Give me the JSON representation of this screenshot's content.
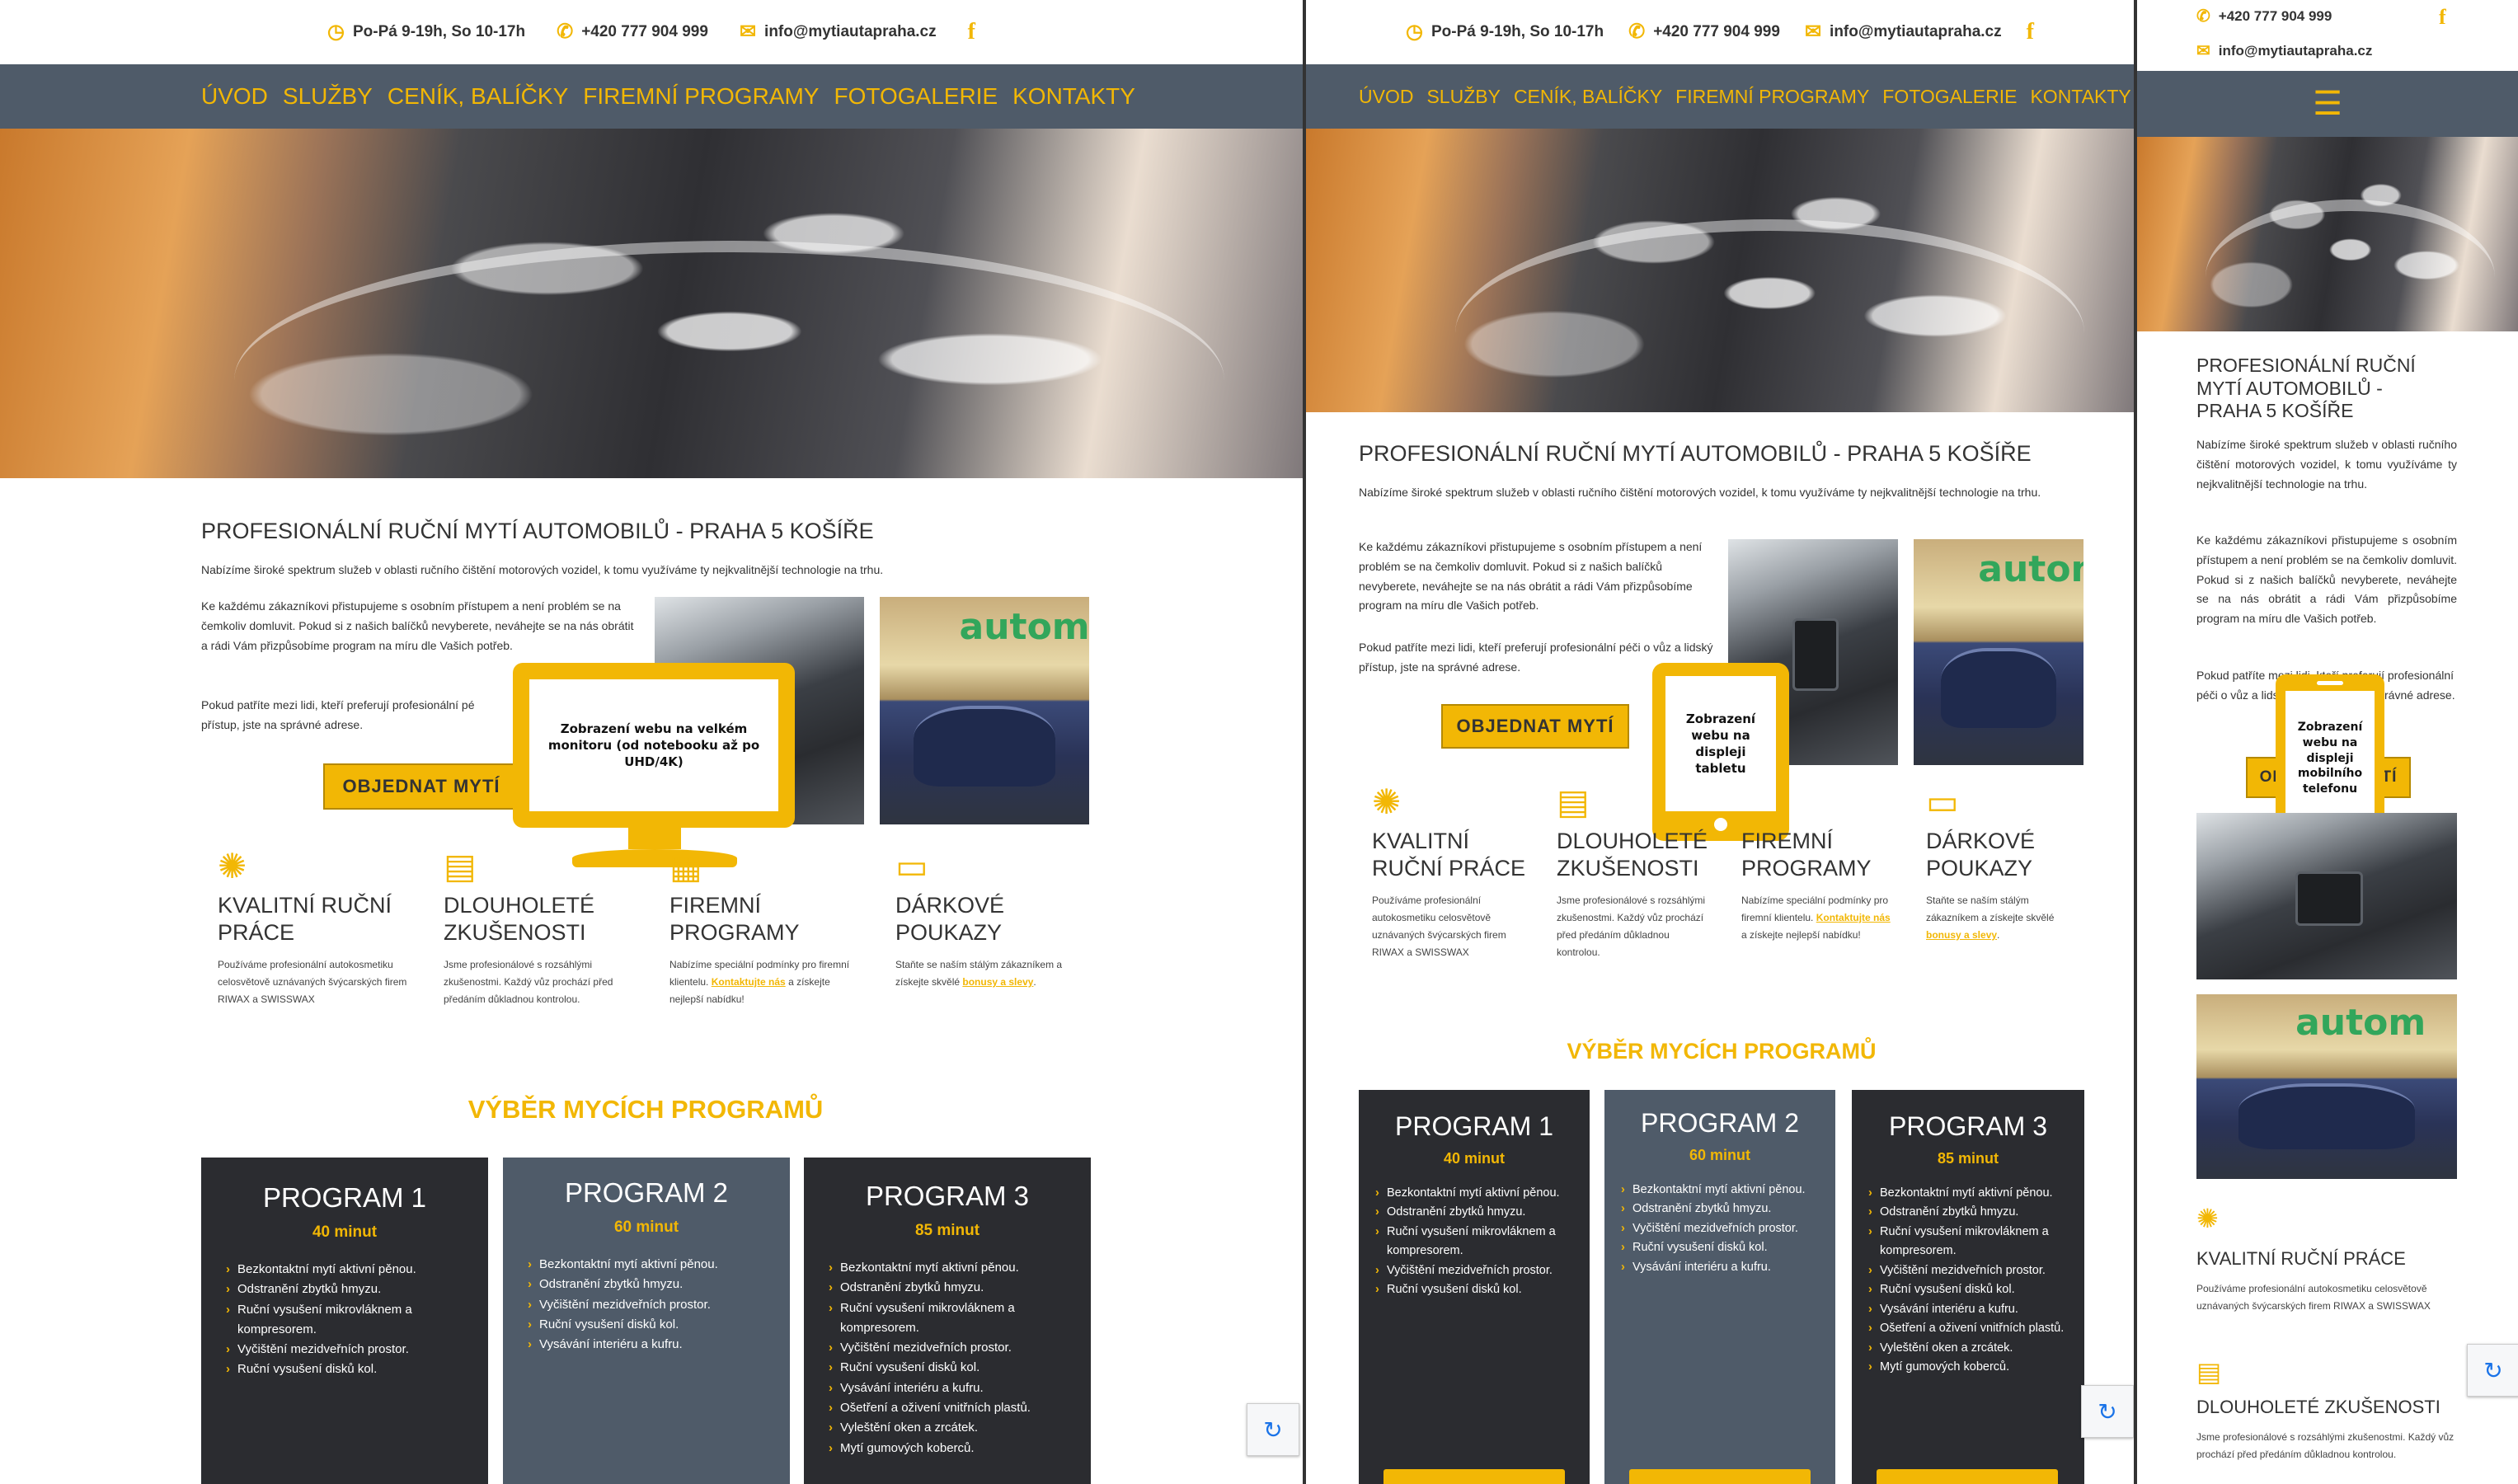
{
  "site": {
    "hours": "Po-Pá 9-19h, So 10-17h",
    "phone": "+420 777 904 999",
    "email": "info@mytiautapraha.cz"
  },
  "nav": [
    "ÚVOD",
    "SLUŽBY",
    "CENÍK, BALÍČKY",
    "FIREMNÍ PROGRAMY",
    "FOTOGALERIE",
    "KONTAKTY"
  ],
  "main": {
    "heading": "PROFESIONÁLNÍ RUČNÍ MYTÍ AUTOMOBILŮ - PRAHA 5 KOŠÍŘE",
    "p1": "Nabízíme široké spektrum služeb v oblasti  ručního čištění motorových vozidel, k tomu využíváme ty nejkvalitnější technologie na trhu.",
    "p2": "Ke každému zákazníkovi přistupujeme s osobním přístupem a není problém se na čemkoliv domluvit.  Pokud si z našich balíčků nevyberete, neváhejte se na nás obrátit a rádi Vám přizpůsobíme program na míru dle Vašich potřeb.",
    "p3": "Pokud patříte mezi lidi, kteří preferují profesionální péči o vůz a lidský přístup, jste na správné adrese.",
    "p3_desktop": "Pokud patříte mezi lidi, kteří preferují profesionální pé",
    "p3_desktop_2": "přístup, jste na správné adrese.",
    "order_button": "OBJEDNAT MYTÍ"
  },
  "features": [
    {
      "title": "KVALITNÍ RUČNÍ PRÁCE",
      "text": "Používáme profesionální autokosmetiku celosvětově uznávaných švýcarských firem RIWAX a SWISSWAX",
      "icon": "sponge-icon"
    },
    {
      "title": "DLOUHOLETÉ ZKUŠENOSTI",
      "text": "Jsme profesionálové s rozsáhlými zkušenostmi. Každý vůz prochází před předáním důkladnou kontrolou.",
      "icon": "document-icon"
    },
    {
      "title": "FIREMNÍ PROGRAMY",
      "text": "Nabízíme speciální podmínky pro firemní klientelu.",
      "link": "Kontaktujte nás",
      "text_after": " a získejte nejlepší nabídku!",
      "icon": "building-icon"
    },
    {
      "title": "DÁRKOVÉ POUKAZY",
      "text": "Staňte se naším stálým zákazníkem a získejte skvělé",
      "link": "bonusy a slevy",
      "text_after": ".",
      "icon": "voucher-icon"
    }
  ],
  "programs_heading": "VÝBĚR MYCÍCH PROGRAMŮ",
  "programs": [
    {
      "name": "PROGRAM 1",
      "duration": "40 minut",
      "items": [
        "Bezkontaktní mytí aktivní pěnou.",
        "Odstranění zbytků hmyzu.",
        "Ruční vysušení mikrovláknem a kompresorem.",
        "Vyčištění mezidveřních prostor.",
        "Ruční vysušení disků kol."
      ]
    },
    {
      "name": "PROGRAM 2",
      "duration": "60 minut",
      "items": [
        "Bezkontaktní mytí aktivní pěnou.",
        "Odstranění zbytků hmyzu.",
        "Vyčištění mezidveřních prostor.",
        "Ruční vysušení disků kol.",
        "Vysávání interiéru a kufru."
      ]
    },
    {
      "name": "PROGRAM 3",
      "duration": "85 minut",
      "items": [
        "Bezkontaktní mytí aktivní pěnou.",
        "Odstranění zbytků hmyzu.",
        "Ruční vysušení mikrovláknem a kompresorem.",
        "Vyčištění mezidveřních prostor.",
        "Ruční vysušení disků kol.",
        "Vysávání interiéru a kufru.",
        "Ošetření a oživení vnitřních plastů.",
        "Vyleštění oken a zrcátek.",
        "Mytí gumových koberců."
      ]
    }
  ],
  "devices": {
    "desktop": "Zobrazení webu na velkém monitoru (od notebooku až po UHD/4K)",
    "tablet": "Zobrazení webu na displeji tabletu",
    "mobile": "Zobrazení webu na displeji mobilního telefonu"
  },
  "colors": {
    "accent": "#f2b705",
    "nav_bg": "#4f5b69",
    "card_dark": "#2b2c30",
    "card_mid": "#4f5b69"
  },
  "icons": {
    "clock": "clock-icon",
    "phone": "phone-icon",
    "mail": "mail-icon",
    "facebook": "facebook-icon",
    "menu": "hamburger-menu-icon",
    "recaptcha": "recaptcha-icon"
  }
}
